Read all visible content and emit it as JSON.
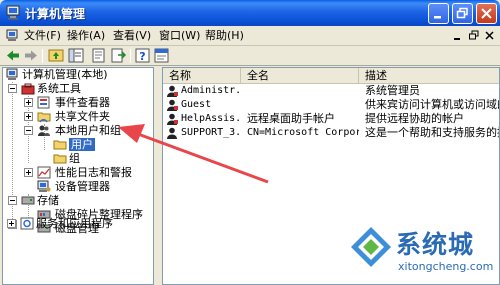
{
  "window": {
    "title": "计算机管理"
  },
  "menu": {
    "items": [
      "文件(F)",
      "操作(A)",
      "查看(V)",
      "窗口(W)",
      "帮助(H)"
    ]
  },
  "toolbar": {
    "buttons": [
      "back-icon",
      "forward-icon",
      "up-icon",
      "show-tree-icon",
      "properties-icon",
      "export-icon",
      "help-icon",
      "help-topics-icon"
    ]
  },
  "tree": {
    "root": "计算机管理(本地)",
    "system_tools": "系统工具",
    "event_viewer": "事件查看器",
    "shared_folders": "共享文件夹",
    "local_users": "本地用户和组",
    "users": "用户",
    "groups": "组",
    "perf_logs": "性能日志和警报",
    "device_manager": "设备管理器",
    "storage": "存储",
    "defrag": "磁盘碎片整理程序",
    "disk_mgmt": "磁盘管理",
    "services": "服务和应用程序"
  },
  "list": {
    "columns": [
      "名称",
      "全名",
      "描述"
    ],
    "rows": [
      {
        "name": "Administr...",
        "fullname": "",
        "desc": "系统管理员"
      },
      {
        "name": "Guest",
        "fullname": "",
        "desc": "供来宾访问计算机或访问域的内"
      },
      {
        "name": "HelpAssis...",
        "fullname": "远程桌面助手帐户",
        "desc": "提供远程协助的帐户"
      },
      {
        "name": "SUPPORT_3...",
        "fullname": "CN=Microsoft Corpora...",
        "desc": "这是一个帮助和支持服务的提供"
      }
    ]
  },
  "watermark": {
    "brand": "系统城",
    "url": "xitongcheng.com"
  },
  "colors": {
    "selection": "#316ac5",
    "title_bar": "#0a52d6",
    "annotation_arrow": "#e8464a"
  }
}
